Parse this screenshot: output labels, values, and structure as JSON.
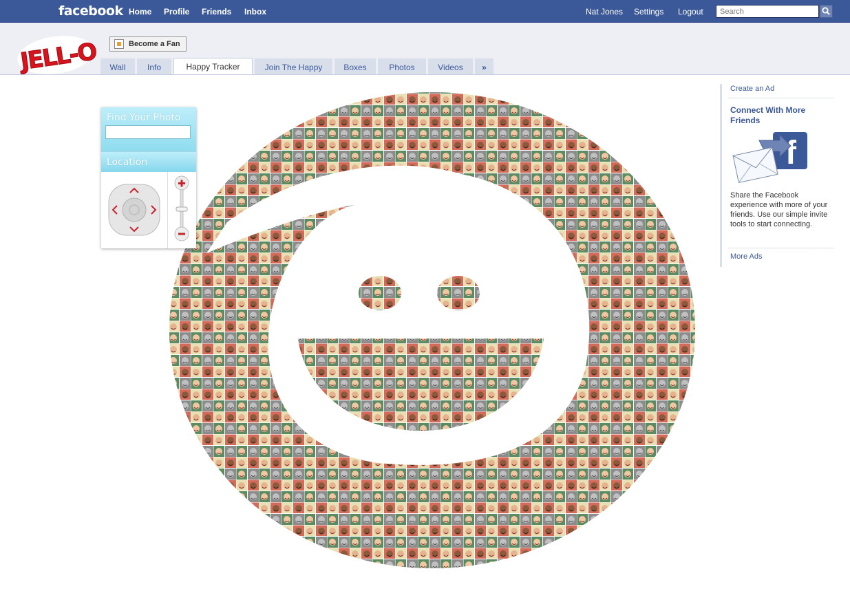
{
  "topbar": {
    "logo": "facebook",
    "nav": [
      "Home",
      "Profile",
      "Friends",
      "Inbox"
    ],
    "user_name": "Nat Jones",
    "settings": "Settings",
    "logout": "Logout",
    "search_placeholder": "Search"
  },
  "page": {
    "brand_logo": "JELL-O",
    "fan_button": "Become a Fan",
    "tabs": [
      "Wall",
      "Info",
      "Happy Tracker",
      "Join The Happy",
      "Boxes",
      "Photos",
      "Videos",
      "»"
    ],
    "active_tab": "Happy Tracker"
  },
  "widget": {
    "find_label": "Find Your Photo",
    "find_value": "",
    "location_label": "Location"
  },
  "ads": {
    "create_ad": "Create an Ad",
    "title": "Connect With More Friends",
    "body": "Share the Facebook experience with more of your friends. Use our simple invite tools to start connecting.",
    "more_ads": "More Ads"
  },
  "colors": {
    "fb_blue": "#3b5998",
    "header_bg": "#edeff4",
    "tab_bg": "#d8dfea",
    "widget_cyan": "#8fdcef",
    "jello_red": "#d7141e"
  },
  "icons": [
    "search-icon",
    "fan-page-icon",
    "direction-pad-icon",
    "zoom-in-icon",
    "zoom-out-icon",
    "envelope-facebook-icon"
  ]
}
